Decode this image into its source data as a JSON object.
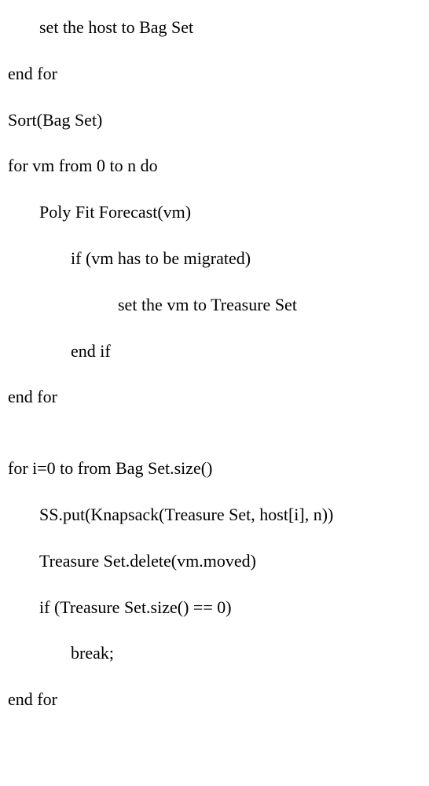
{
  "lines": [
    {
      "text": "set the host to Bag Set",
      "indent": 1
    },
    {
      "text": "end for",
      "indent": 0
    },
    {
      "text": "Sort(Bag Set)",
      "indent": 0
    },
    {
      "text": "for vm from 0 to n do",
      "indent": 0
    },
    {
      "text": "Poly Fit Forecast(vm)",
      "indent": 1
    },
    {
      "text": "if (vm has to be migrated)",
      "indent": 2
    },
    {
      "text": "set the vm to Treasure Set",
      "indent": 3
    },
    {
      "text": "end if",
      "indent": 2
    },
    {
      "text": "end for",
      "indent": 0,
      "gap": true
    },
    {
      "text": "for i=0 to from Bag Set.size()",
      "indent": 0
    },
    {
      "text": "SS.put(Knapsack(Treasure Set, host[i], n))",
      "indent": 1
    },
    {
      "text": "Treasure Set.delete(vm.moved)",
      "indent": 1
    },
    {
      "text": "if (Treasure Set.size() == 0)",
      "indent": 1
    },
    {
      "text": "break;",
      "indent": 2
    },
    {
      "text": "end for",
      "indent": 0
    }
  ]
}
